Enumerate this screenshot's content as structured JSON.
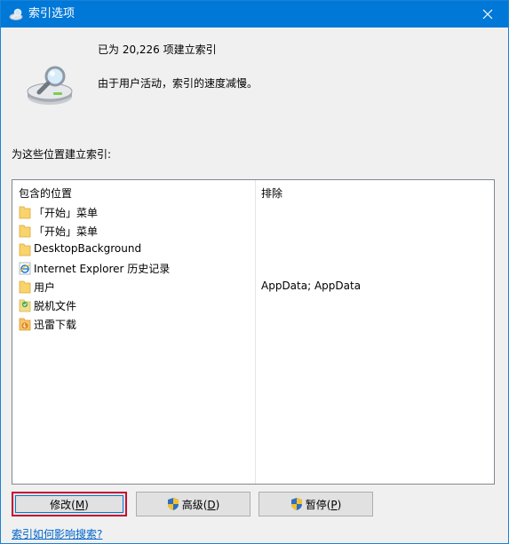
{
  "window": {
    "title": "索引选项",
    "title_icon": "indexing-options-icon",
    "close_icon": "close-icon"
  },
  "status": {
    "count_text": "已为 20,226 项建立索引",
    "message": "由于用户活动，索引的速度减慢。",
    "icon": "drive-magnifier-icon"
  },
  "locations": {
    "label": "为这些位置建立索引:",
    "columns": {
      "included": "包含的位置",
      "excluded": "排除"
    },
    "items": [
      {
        "name": "「开始」菜单",
        "exclude": "",
        "icon": "folder-icon"
      },
      {
        "name": "「开始」菜单",
        "exclude": "",
        "icon": "folder-icon"
      },
      {
        "name": "DesktopBackground",
        "exclude": "",
        "icon": "folder-icon"
      },
      {
        "name": "Internet Explorer 历史记录",
        "exclude": "",
        "icon": "ie-icon"
      },
      {
        "name": "用户",
        "exclude": "AppData; AppData",
        "icon": "folder-icon"
      },
      {
        "name": "脱机文件",
        "exclude": "",
        "icon": "offline-files-icon"
      },
      {
        "name": "迅雷下载",
        "exclude": "",
        "icon": "thunder-download-icon"
      }
    ]
  },
  "buttons": {
    "modify": {
      "text": "修改(",
      "key": "M",
      "end": ")"
    },
    "advanced": {
      "text": "高级(",
      "key": "D",
      "end": ")"
    },
    "pause": {
      "text": "暂停(",
      "key": "P",
      "end": ")"
    }
  },
  "help_link": "索引如何影响搜索?",
  "colors": {
    "titlebar": "#0078d7",
    "default_button_outline": "#c8102e",
    "link": "#0066cc"
  }
}
